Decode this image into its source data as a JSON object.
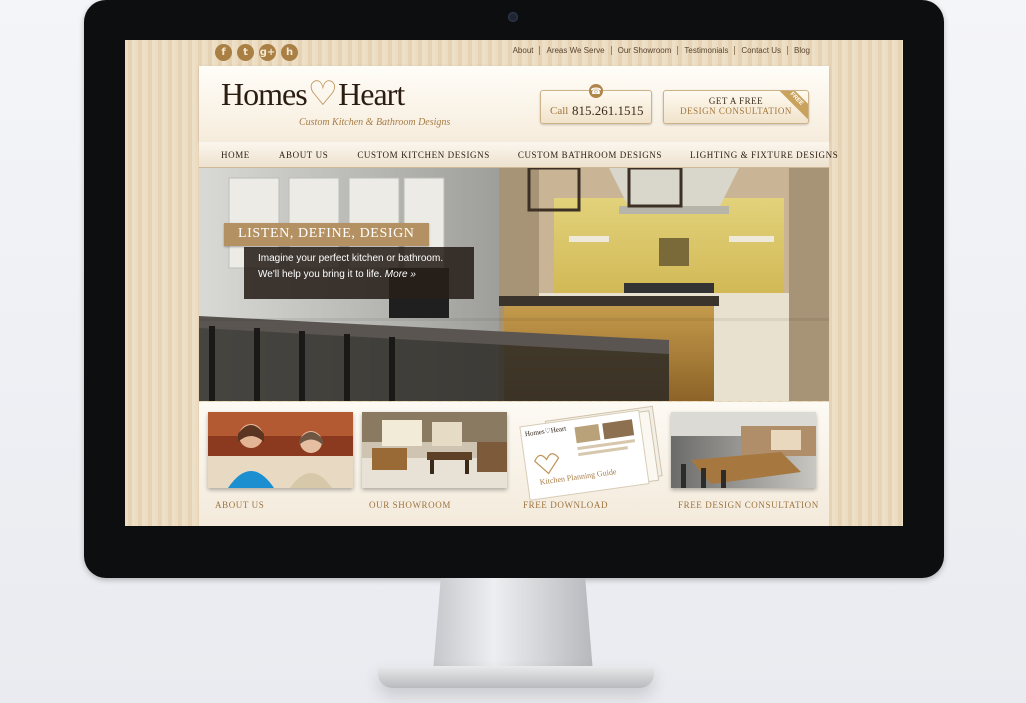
{
  "device": {
    "type": "desktop monitor"
  },
  "topbar": {
    "social": [
      {
        "icon": "facebook-icon",
        "glyph": "f"
      },
      {
        "icon": "twitter-icon",
        "glyph": "t"
      },
      {
        "icon": "google-plus-icon",
        "glyph": "g+"
      },
      {
        "icon": "houzz-icon",
        "glyph": "h"
      }
    ],
    "links": [
      "About",
      "Areas We Serve",
      "Our Showroom",
      "Testimonials",
      "Contact Us",
      "Blog"
    ]
  },
  "header": {
    "logo_word1": "Homes",
    "logo_heart": "♡",
    "logo_word2": "Heart",
    "tagline": "Custom Kitchen & Bathroom Designs",
    "call_label": "Call",
    "phone": "815.261.1515",
    "consult_line1": "GET A FREE",
    "consult_line2": "DESIGN CONSULTATION",
    "consult_ribbon": "FREE"
  },
  "nav": {
    "items": [
      "HOME",
      "ABOUT US",
      "CUSTOM KITCHEN DESIGNS",
      "CUSTOM BATHROOM DESIGNS",
      "LIGHTING & FIXTURE DESIGNS"
    ]
  },
  "hero": {
    "title": "LISTEN, DEFINE, DESIGN",
    "text": "Imagine your perfect kitchen or bathroom. We'll help you bring it to life.",
    "more_link": "More »"
  },
  "cards": [
    {
      "label": "ABOUT US"
    },
    {
      "label": "OUR SHOWROOM"
    },
    {
      "label": "FREE DOWNLOAD",
      "thumb_title": "Kitchen Planning Guide",
      "thumb_brand": "Homes♡Heart"
    },
    {
      "label": "FREE DESIGN CONSULTATION"
    }
  ],
  "colors": {
    "accent": "#a97f44",
    "dark_text": "#2b1d12",
    "wood": "#e8d7bd",
    "monitor_bezel": "#0d0e10"
  }
}
